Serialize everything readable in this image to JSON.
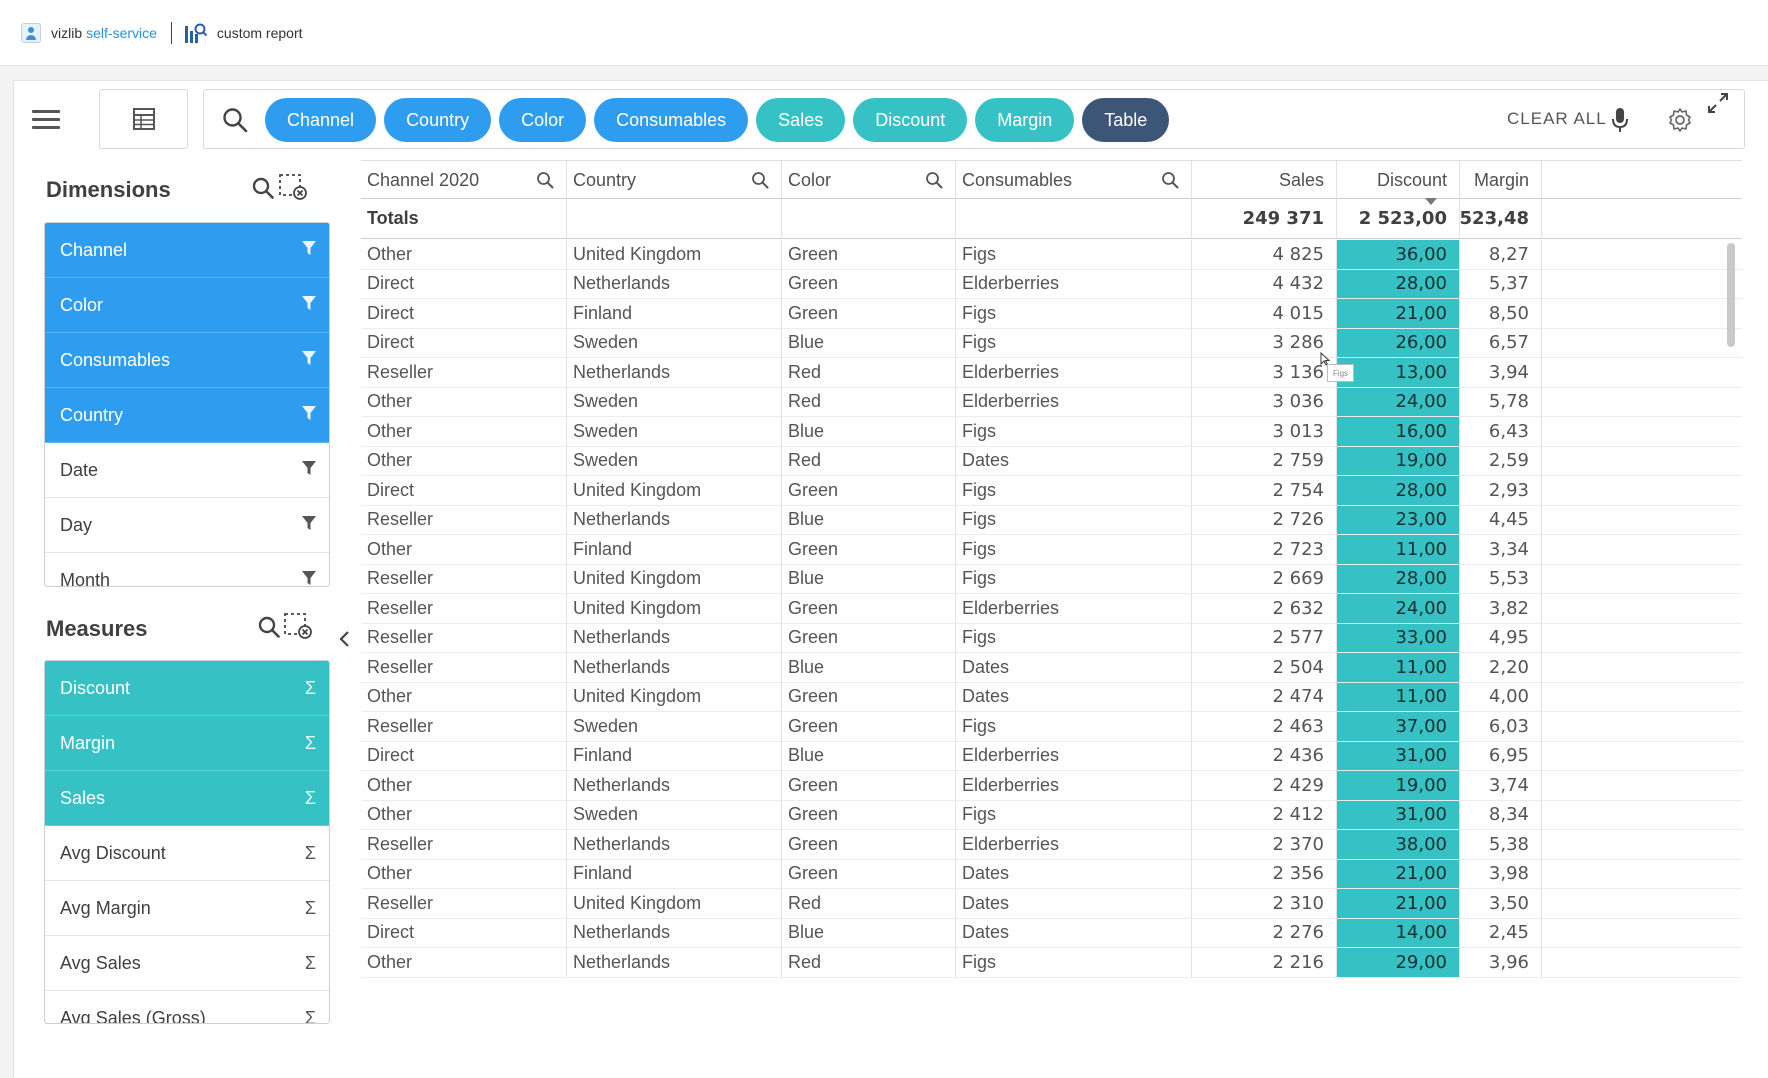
{
  "brand": {
    "name_a": "vizlib",
    "name_b": "self-service",
    "report_label": "custom report"
  },
  "toolbar": {
    "chips": [
      {
        "label": "Channel",
        "kind": "dimension"
      },
      {
        "label": "Country",
        "kind": "dimension"
      },
      {
        "label": "Color",
        "kind": "dimension"
      },
      {
        "label": "Consumables",
        "kind": "dimension"
      },
      {
        "label": "Sales",
        "kind": "measure"
      },
      {
        "label": "Discount",
        "kind": "measure"
      },
      {
        "label": "Margin",
        "kind": "measure"
      },
      {
        "label": "Table",
        "kind": "chart"
      }
    ],
    "clear_all": "CLEAR ALL"
  },
  "dimensions": {
    "title": "Dimensions",
    "items": [
      {
        "label": "Channel",
        "active": true
      },
      {
        "label": "Color",
        "active": true
      },
      {
        "label": "Consumables",
        "active": true
      },
      {
        "label": "Country",
        "active": true
      },
      {
        "label": "Date",
        "active": false
      },
      {
        "label": "Day",
        "active": false
      },
      {
        "label": "Month",
        "active": false
      }
    ]
  },
  "measures": {
    "title": "Measures",
    "items": [
      {
        "label": "Discount",
        "active": true
      },
      {
        "label": "Margin",
        "active": true
      },
      {
        "label": "Sales",
        "active": true
      },
      {
        "label": "Avg Discount",
        "active": false
      },
      {
        "label": "Avg Margin",
        "active": false
      },
      {
        "label": "Avg Sales",
        "active": false
      },
      {
        "label": "Avg Sales (Gross)",
        "active": false
      }
    ]
  },
  "table": {
    "columns": [
      "Channel 2020",
      "Country",
      "Color",
      "Consumables",
      "Sales",
      "Discount",
      "Margin"
    ],
    "totals": {
      "label": "Totals",
      "sales": "249 371",
      "discount": "2 523,00",
      "margin": "523,48"
    },
    "rows": [
      [
        "Other",
        "United Kingdom",
        "Green",
        "Figs",
        "4 825",
        "36,00",
        "8,27"
      ],
      [
        "Direct",
        "Netherlands",
        "Green",
        "Elderberries",
        "4 432",
        "28,00",
        "5,37"
      ],
      [
        "Direct",
        "Finland",
        "Green",
        "Figs",
        "4 015",
        "21,00",
        "8,50"
      ],
      [
        "Direct",
        "Sweden",
        "Blue",
        "Figs",
        "3 286",
        "26,00",
        "6,57"
      ],
      [
        "Reseller",
        "Netherlands",
        "Red",
        "Elderberries",
        "3 136",
        "13,00",
        "3,94"
      ],
      [
        "Other",
        "Sweden",
        "Red",
        "Elderberries",
        "3 036",
        "24,00",
        "5,78"
      ],
      [
        "Other",
        "Sweden",
        "Blue",
        "Figs",
        "3 013",
        "16,00",
        "6,43"
      ],
      [
        "Other",
        "Sweden",
        "Red",
        "Dates",
        "2 759",
        "19,00",
        "2,59"
      ],
      [
        "Direct",
        "United Kingdom",
        "Green",
        "Figs",
        "2 754",
        "28,00",
        "2,93"
      ],
      [
        "Reseller",
        "Netherlands",
        "Blue",
        "Figs",
        "2 726",
        "23,00",
        "4,45"
      ],
      [
        "Other",
        "Finland",
        "Green",
        "Figs",
        "2 723",
        "11,00",
        "3,34"
      ],
      [
        "Reseller",
        "United Kingdom",
        "Blue",
        "Figs",
        "2 669",
        "28,00",
        "5,53"
      ],
      [
        "Reseller",
        "United Kingdom",
        "Green",
        "Elderberries",
        "2 632",
        "24,00",
        "3,82"
      ],
      [
        "Reseller",
        "Netherlands",
        "Green",
        "Figs",
        "2 577",
        "33,00",
        "4,95"
      ],
      [
        "Reseller",
        "Netherlands",
        "Blue",
        "Dates",
        "2 504",
        "11,00",
        "2,20"
      ],
      [
        "Other",
        "United Kingdom",
        "Green",
        "Dates",
        "2 474",
        "11,00",
        "4,00"
      ],
      [
        "Reseller",
        "Sweden",
        "Green",
        "Figs",
        "2 463",
        "37,00",
        "6,03"
      ],
      [
        "Direct",
        "Finland",
        "Blue",
        "Elderberries",
        "2 436",
        "31,00",
        "6,95"
      ],
      [
        "Other",
        "Netherlands",
        "Green",
        "Elderberries",
        "2 429",
        "19,00",
        "3,74"
      ],
      [
        "Other",
        "Sweden",
        "Green",
        "Figs",
        "2 412",
        "31,00",
        "8,34"
      ],
      [
        "Reseller",
        "Netherlands",
        "Green",
        "Elderberries",
        "2 370",
        "38,00",
        "5,38"
      ],
      [
        "Other",
        "Finland",
        "Green",
        "Dates",
        "2 356",
        "21,00",
        "3,98"
      ],
      [
        "Reseller",
        "United Kingdom",
        "Red",
        "Dates",
        "2 310",
        "21,00",
        "3,50"
      ],
      [
        "Direct",
        "Netherlands",
        "Blue",
        "Dates",
        "2 276",
        "14,00",
        "2,45"
      ],
      [
        "Other",
        "Netherlands",
        "Red",
        "Figs",
        "2 216",
        "29,00",
        "3,96"
      ]
    ]
  },
  "tooltip": "Figs",
  "colors": {
    "dimension": "#2e9cef",
    "measure": "#36c2c4",
    "chart": "#3d5678"
  }
}
